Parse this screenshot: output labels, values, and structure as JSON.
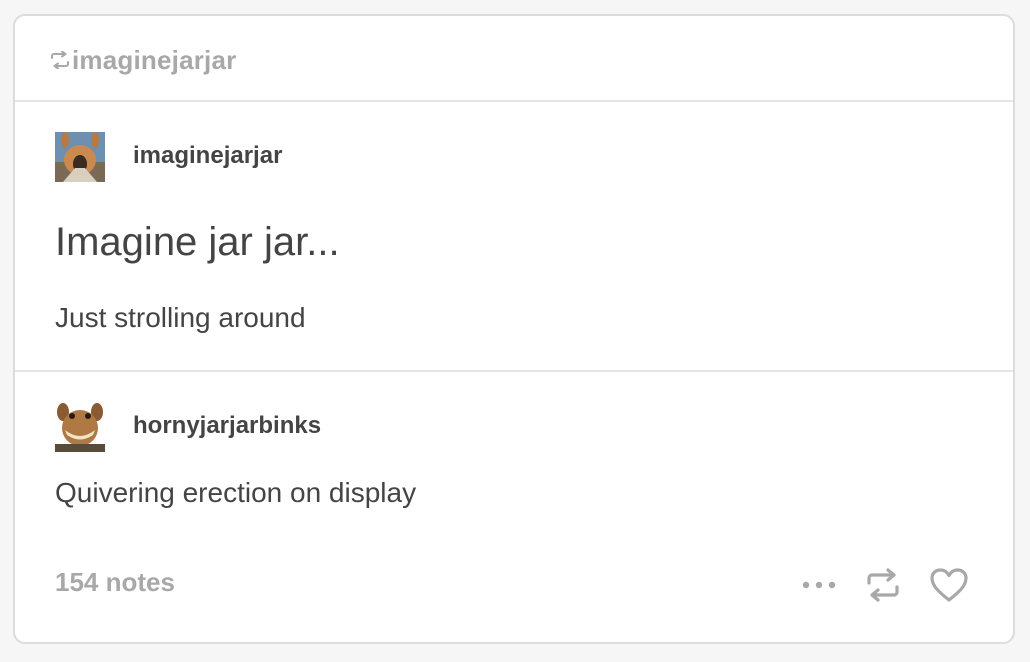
{
  "reblog_header": {
    "reblogged_from": "imaginejarjar",
    "icon": "reblog-icon"
  },
  "original_post": {
    "avatar_icon": "avatar-image",
    "username": "imaginejarjar",
    "title": "Imagine jar jar...",
    "body": "Just strolling around"
  },
  "reply_post": {
    "avatar_icon": "avatar-image",
    "username": "hornyjarjarbinks",
    "body": "Quivering erection on display"
  },
  "footer": {
    "notes": "154 notes",
    "actions": [
      "more-options-icon",
      "reblog-icon",
      "heart-icon"
    ]
  },
  "colors": {
    "text_primary": "#444444",
    "text_muted": "#a8a8a8",
    "border": "#e4e4e4"
  }
}
